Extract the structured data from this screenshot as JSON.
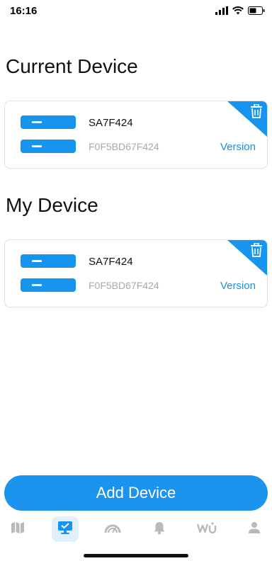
{
  "status_bar": {
    "time": "16:16"
  },
  "sections": {
    "current": {
      "title": "Current Device",
      "device": {
        "name": "SA7F424",
        "mac": "F0F5BD67F424",
        "version_label": "Version"
      }
    },
    "my": {
      "title": "My Device",
      "device": {
        "name": "SA7F424",
        "mac": "F0F5BD67F424",
        "version_label": "Version"
      }
    }
  },
  "actions": {
    "add_device_label": "Add Device"
  },
  "tab_bar": {
    "items": [
      "map-icon",
      "device-icon",
      "gauge-icon",
      "bell-icon",
      "wu-logo-icon",
      "profile-icon"
    ],
    "active": "device-icon"
  },
  "colors": {
    "accent": "#1794ee",
    "muted_text": "#a8a8a8",
    "link": "#1a8fe3"
  }
}
